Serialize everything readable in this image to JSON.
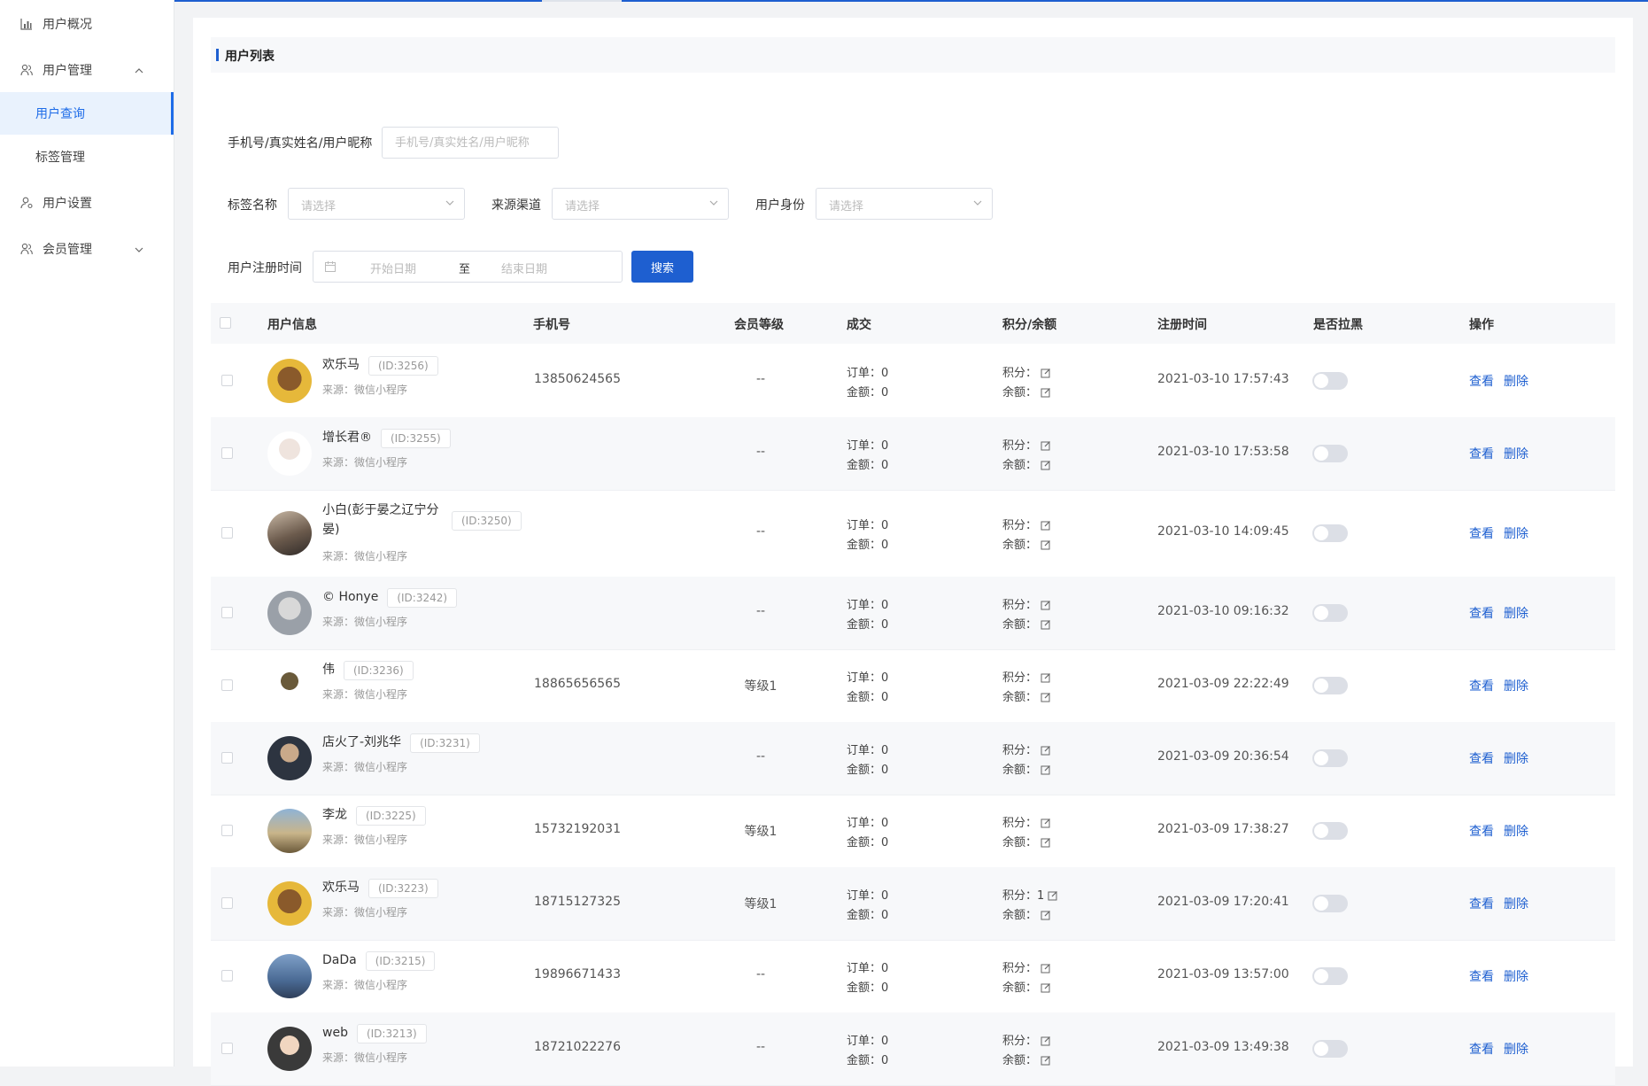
{
  "colors": {
    "primary": "#1e5fd0",
    "sidebar_active_bg": "#e9f2fd"
  },
  "sidebar": {
    "overview": "用户概况",
    "user_mgmt": "用户管理",
    "user_query": "用户查询",
    "tag_mgmt": "标签管理",
    "user_settings": "用户设置",
    "member_mgmt": "会员管理"
  },
  "page": {
    "title": "用户列表"
  },
  "filters": {
    "keyword_label": "手机号/真实姓名/用户昵称",
    "keyword_placeholder": "手机号/真实姓名/用户昵称",
    "tag_label": "标签名称",
    "tag_placeholder": "请选择",
    "channel_label": "来源渠道",
    "channel_placeholder": "请选择",
    "identity_label": "用户身份",
    "identity_placeholder": "请选择",
    "date_label": "用户注册时间",
    "date_start": "开始日期",
    "date_sep": "至",
    "date_end": "结束日期",
    "search_button": "搜索"
  },
  "table": {
    "headers": {
      "user_info": "用户信息",
      "phone": "手机号",
      "level": "会员等级",
      "deal": "成交",
      "points": "积分/余额",
      "reg_time": "注册时间",
      "blacklist": "是否拉黑",
      "ops": "操作"
    },
    "rows": [
      {
        "name": "欢乐马",
        "id": "(ID:3256)",
        "source": "来源：微信小程序",
        "phone": "13850624565",
        "level": "--",
        "orders": "订单：0",
        "amount": "金额：0",
        "points": "积分：",
        "balance": "余额：",
        "reg_time": "2021-03-10 17:57:43",
        "blacklisted": false,
        "view": "查看",
        "delete": "删除"
      },
      {
        "name": "增长君®",
        "id": "(ID:3255)",
        "source": "来源：微信小程序",
        "phone": "",
        "level": "--",
        "orders": "订单：0",
        "amount": "金额：0",
        "points": "积分：",
        "balance": "余额：",
        "reg_time": "2021-03-10 17:53:58",
        "blacklisted": false,
        "view": "查看",
        "delete": "删除"
      },
      {
        "name": "小白(彭于晏之辽宁分晏)",
        "id": "(ID:3250)",
        "source": "来源：微信小程序",
        "phone": "",
        "level": "--",
        "orders": "订单：0",
        "amount": "金额：0",
        "points": "积分：",
        "balance": "余额：",
        "reg_time": "2021-03-10 14:09:45",
        "blacklisted": false,
        "view": "查看",
        "delete": "删除"
      },
      {
        "name": "© Honye",
        "id": "(ID:3242)",
        "source": "来源：微信小程序",
        "phone": "",
        "level": "--",
        "orders": "订单：0",
        "amount": "金额：0",
        "points": "积分：",
        "balance": "余额：",
        "reg_time": "2021-03-10 09:16:32",
        "blacklisted": false,
        "view": "查看",
        "delete": "删除"
      },
      {
        "name": "伟",
        "id": "(ID:3236)",
        "source": "来源：微信小程序",
        "phone": "18865656565",
        "level": "等级1",
        "orders": "订单：0",
        "amount": "金额：0",
        "points": "积分：",
        "balance": "余额：",
        "reg_time": "2021-03-09 22:22:49",
        "blacklisted": false,
        "view": "查看",
        "delete": "删除"
      },
      {
        "name": "店火了-刘兆华",
        "id": "(ID:3231)",
        "source": "来源：微信小程序",
        "phone": "",
        "level": "--",
        "orders": "订单：0",
        "amount": "金额：0",
        "points": "积分：",
        "balance": "余额：",
        "reg_time": "2021-03-09 20:36:54",
        "blacklisted": false,
        "view": "查看",
        "delete": "删除"
      },
      {
        "name": "李龙",
        "id": "(ID:3225)",
        "source": "来源：微信小程序",
        "phone": "15732192031",
        "level": "等级1",
        "orders": "订单：0",
        "amount": "金额：0",
        "points": "积分：",
        "balance": "余额：",
        "reg_time": "2021-03-09 17:38:27",
        "blacklisted": false,
        "view": "查看",
        "delete": "删除"
      },
      {
        "name": "欢乐马",
        "id": "(ID:3223)",
        "source": "来源：微信小程序",
        "phone": "18715127325",
        "level": "等级1",
        "orders": "订单：0",
        "amount": "金额：0",
        "points": "积分：1",
        "balance": "余额：",
        "reg_time": "2021-03-09 17:20:41",
        "blacklisted": false,
        "view": "查看",
        "delete": "删除"
      },
      {
        "name": "DaDa",
        "id": "(ID:3215)",
        "source": "来源：微信小程序",
        "phone": "19896671433",
        "level": "--",
        "orders": "订单：0",
        "amount": "金额：0",
        "points": "积分：",
        "balance": "余额：",
        "reg_time": "2021-03-09 13:57:00",
        "blacklisted": false,
        "view": "查看",
        "delete": "删除"
      },
      {
        "name": "web",
        "id": "(ID:3213)",
        "source": "来源：微信小程序",
        "phone": "18721022276",
        "level": "--",
        "orders": "订单：0",
        "amount": "金额：0",
        "points": "积分：",
        "balance": "余额：",
        "reg_time": "2021-03-09 13:49:38",
        "blacklisted": false,
        "view": "查看",
        "delete": "删除"
      }
    ]
  }
}
